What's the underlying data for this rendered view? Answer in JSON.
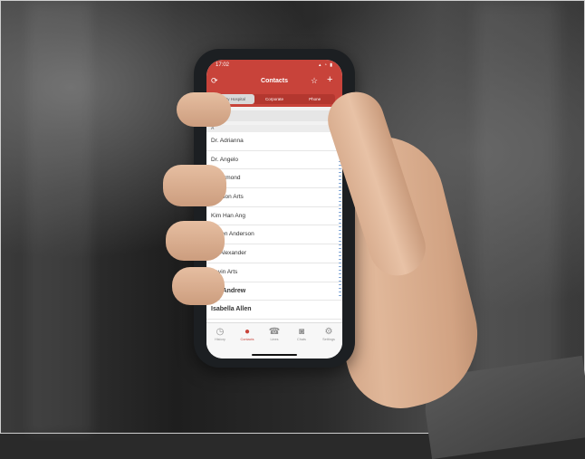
{
  "status_bar": {
    "time": "17:02",
    "icons": "▴ ◔ ▮"
  },
  "header": {
    "refresh_icon": "refresh-icon",
    "title": "Contacts",
    "star_icon": "star-icon",
    "add_icon": "plus-icon"
  },
  "segments": [
    "City Hospital",
    "Corporate",
    "Phone"
  ],
  "search": {
    "placeholder_icon": "search-icon"
  },
  "section_letter": "A",
  "contacts": [
    "Dr. Adrianna",
    "Dr. Angelo",
    "Dr. Armond",
    "Mayson Arts",
    "Kim Han Ang",
    "Shven Anderson",
    "Dr. Alexander",
    "Kevin Arts",
    "Bill Andrew",
    "Isabella Allen"
  ],
  "tabs": [
    {
      "label": "History",
      "icon": "history-icon"
    },
    {
      "label": "Contacts",
      "icon": "person-icon"
    },
    {
      "label": "Lines",
      "icon": "phone-icon"
    },
    {
      "label": "Chats",
      "icon": "chat-icon"
    },
    {
      "label": "Settings",
      "icon": "gear-icon"
    }
  ],
  "colors": {
    "brand": "#c8433a"
  }
}
